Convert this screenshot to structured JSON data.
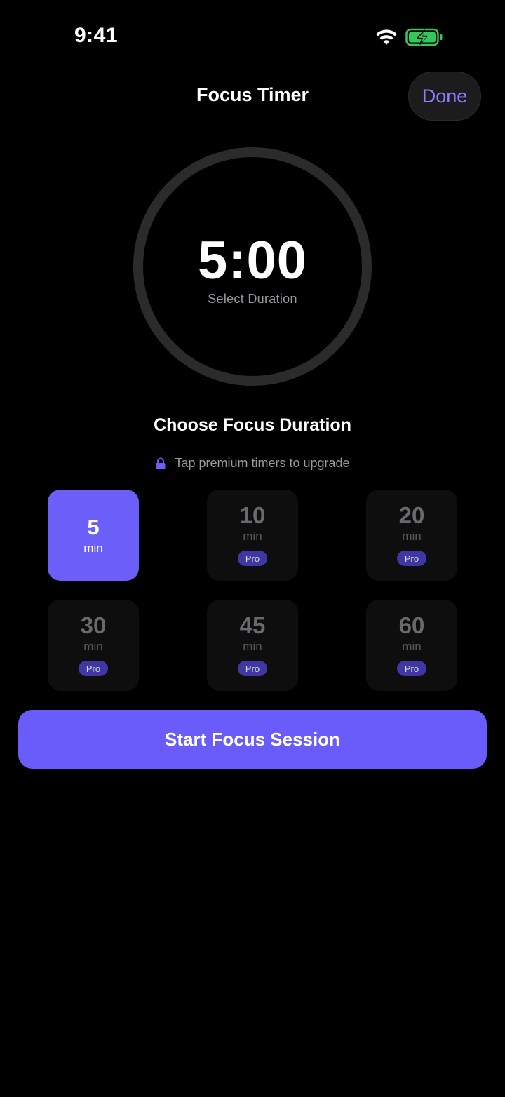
{
  "status_bar": {
    "time": "9:41",
    "wifi_icon": "wifi-icon",
    "battery_icon": "battery-charging-icon",
    "battery_color": "#34c759"
  },
  "nav": {
    "title": "Focus Timer",
    "done_label": "Done"
  },
  "timer": {
    "value": "5:00",
    "caption": "Select Duration"
  },
  "section": {
    "title": "Choose Focus Duration",
    "hint": "Tap premium timers to upgrade",
    "hint_icon": "lock-icon"
  },
  "durations": [
    {
      "value": "5",
      "unit": "min",
      "badge": "",
      "selected": true
    },
    {
      "value": "10",
      "unit": "min",
      "badge": "Pro",
      "selected": false
    },
    {
      "value": "20",
      "unit": "min",
      "badge": "Pro",
      "selected": false
    },
    {
      "value": "30",
      "unit": "min",
      "badge": "Pro",
      "selected": false
    },
    {
      "value": "45",
      "unit": "min",
      "badge": "Pro",
      "selected": false
    },
    {
      "value": "60",
      "unit": "min",
      "badge": "Pro",
      "selected": false
    }
  ],
  "start_button_label": "Start Focus Session",
  "colors": {
    "accent": "#6c5ff9",
    "pro_badge": "#4a3fbf",
    "done_text": "#8b80ff"
  }
}
